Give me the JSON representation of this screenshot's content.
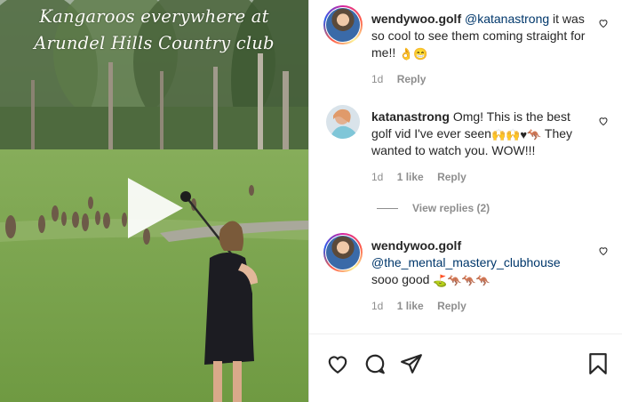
{
  "video": {
    "caption_line1": "Kangaroos everywhere at",
    "caption_line2": "Arundel Hills Country club",
    "play_icon": "play-icon"
  },
  "comments": [
    {
      "username": "wendywoo.golf",
      "mention": "@katanastrong",
      "text": " it was so cool to see them coming straight for me!! ",
      "emojis": "👌😁",
      "time": "1d",
      "reply": "Reply"
    },
    {
      "username": "katanastrong",
      "text": "Omg! This is the best golf vid I've ever seen",
      "emojis": "🙌🙌♥🦘",
      "text2": " They wanted to watch you. WOW!!!",
      "time": "1d",
      "likes": "1 like",
      "reply": "Reply",
      "view_replies": "View replies (2)"
    },
    {
      "username": "wendywoo.golf",
      "mention": "@the_mental_mastery_clubhouse",
      "text": "sooo good ",
      "emojis": "⛳🦘🦘🦘",
      "time": "1d",
      "likes": "1 like",
      "reply": "Reply"
    }
  ],
  "actions": [
    "heart-icon",
    "comment-icon",
    "share-icon",
    "bookmark-icon"
  ],
  "colors": {
    "text": "#262626",
    "muted": "#8e8e8e",
    "mention": "#00376b",
    "border": "#dbdbdb"
  }
}
